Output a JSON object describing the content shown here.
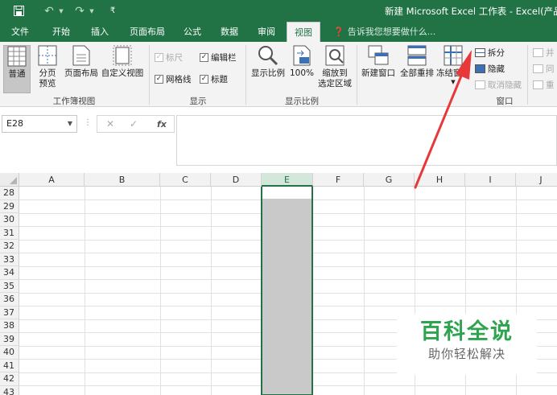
{
  "title_bar": {
    "window_title": "新建 Microsoft Excel 工作表 - Excel(产品激活",
    "qat": {
      "save_icon": "save-icon",
      "undo_icon": "undo-icon",
      "redo_icon": "redo-icon",
      "customize_icon": "customize-qat-icon"
    }
  },
  "tabs": [
    {
      "label": "文件"
    },
    {
      "label": "开始"
    },
    {
      "label": "插入"
    },
    {
      "label": "页面布局"
    },
    {
      "label": "公式"
    },
    {
      "label": "数据"
    },
    {
      "label": "审阅"
    },
    {
      "label": "视图",
      "active": true
    }
  ],
  "tell_me": "告诉我您想要做什么...",
  "ribbon": {
    "workbook_views": {
      "label": "工作簿视图",
      "normal": "普通",
      "page_break_1": "分页",
      "page_break_2": "预览",
      "page_layout": "页面布局",
      "custom_views": "自定义视图"
    },
    "show": {
      "label": "显示",
      "ruler": {
        "label": "标尺",
        "checked": true,
        "disabled": true
      },
      "formula_bar": {
        "label": "编辑栏",
        "checked": true
      },
      "gridlines": {
        "label": "网格线",
        "checked": true
      },
      "headings": {
        "label": "标题",
        "checked": true
      }
    },
    "zoom": {
      "label": "显示比例",
      "zoom_btn": "显示比例",
      "hundred": "100%",
      "zoom_sel_1": "缩放到",
      "zoom_sel_2": "选定区域"
    },
    "window": {
      "label": "窗口",
      "new_window": "新建窗口",
      "arrange_all": "全部重排",
      "freeze_panes": "冻结窗格",
      "split": "拆分",
      "hide": "隐藏",
      "unhide": "取消隐藏",
      "side_by_side": "并",
      "sync_scroll": "同",
      "reset_pos": "重"
    }
  },
  "formula_bar": {
    "name_box": "E28",
    "cancel": "✕",
    "enter": "✓",
    "fx": "fx",
    "value": ""
  },
  "grid": {
    "columns": [
      "A",
      "B",
      "C",
      "D",
      "E",
      "F",
      "G",
      "H",
      "I",
      "J"
    ],
    "selected_column": "E",
    "rows": [
      "28",
      "29",
      "30",
      "31",
      "32",
      "33",
      "34",
      "35",
      "36",
      "37",
      "38",
      "39",
      "40",
      "41",
      "42",
      "43"
    ]
  },
  "watermark": {
    "title": "百科全说",
    "subtitle": "助你轻松解决"
  },
  "colors": {
    "accent": "#217346",
    "arrow": "#e8393a",
    "watermark": "#2ea44f"
  }
}
